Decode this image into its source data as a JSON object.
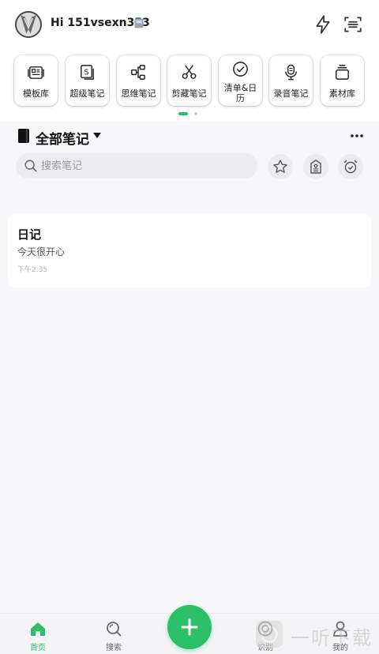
{
  "header": {
    "greeting": "Hi 151vsexn353"
  },
  "tools": [
    {
      "label": "模板库",
      "icon": "template-icon"
    },
    {
      "label": "超级笔记",
      "icon": "super-note-icon"
    },
    {
      "label": "思维笔记",
      "icon": "mindmap-icon"
    },
    {
      "label": "剪藏笔记",
      "icon": "scissors-icon"
    },
    {
      "label": "清单&日历",
      "icon": "check-circle-icon"
    },
    {
      "label": "录音笔记",
      "icon": "microphone-icon"
    },
    {
      "label": "素材库",
      "icon": "material-icon"
    }
  ],
  "notes_section": {
    "title": "全部笔记",
    "search_placeholder": "搜索笔记"
  },
  "notes": [
    {
      "title": "日记",
      "body": "今天很开心",
      "time": "下午2:35"
    }
  ],
  "bottom_nav": {
    "home": "首页",
    "search": "搜索",
    "recognize": "识别",
    "mine": "我的"
  },
  "watermark": {
    "text": "一听下载"
  },
  "colors": {
    "accent": "#2bbf67",
    "background": "#f7f7f9"
  }
}
